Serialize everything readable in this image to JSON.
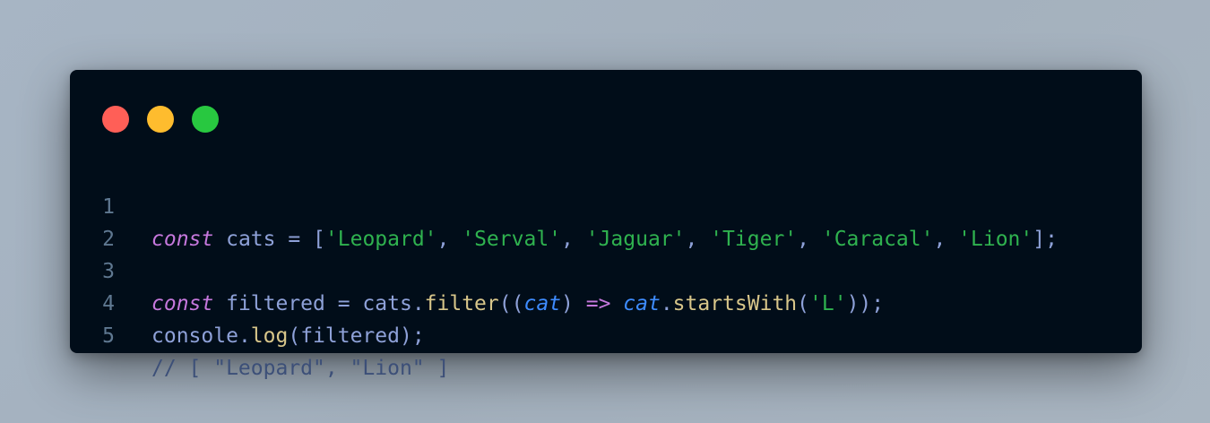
{
  "window_controls": {
    "close_color": "#ff5f57",
    "minimize_color": "#febc2e",
    "zoom_color": "#28c840"
  },
  "colors": {
    "background": "#010d19",
    "keyword": "#c678dd",
    "string": "#2fb24f",
    "function": "#d8c68a",
    "parameter": "#3e8cff",
    "comment": "#3c4f78",
    "identifier": "#8ea1d8",
    "line_number": "#5f7891"
  },
  "code": {
    "line_numbers": [
      "1",
      "2",
      "3",
      "4",
      "5"
    ],
    "line1": {
      "kw": "const",
      "name": " cats",
      "eq": " = ",
      "open": "[",
      "s1": "'Leopard'",
      "c1": ", ",
      "s2": "'Serval'",
      "c2": ", ",
      "s3": "'Jaguar'",
      "c3": ", ",
      "s4": "'Tiger'",
      "c4": ", ",
      "s5": "'Caracal'",
      "c5": ", ",
      "s6": "'Lion'",
      "close": "];"
    },
    "line3": {
      "kw": "const",
      "name": " filtered",
      "eq": " = ",
      "obj": "cats",
      "dot1": ".",
      "fn1": "filter",
      "open": "((",
      "param1": "cat",
      "close_paren": ")",
      "arrow": " => ",
      "param2": "cat",
      "dot2": ".",
      "fn2": "startsWith",
      "open2": "(",
      "str": "'L'",
      "end": "));"
    },
    "line4": {
      "obj": "console",
      "dot": ".",
      "fn": "log",
      "args": "(filtered);"
    },
    "line5": {
      "comment": "// [ \"Leopard\", \"Lion\" ]"
    }
  }
}
